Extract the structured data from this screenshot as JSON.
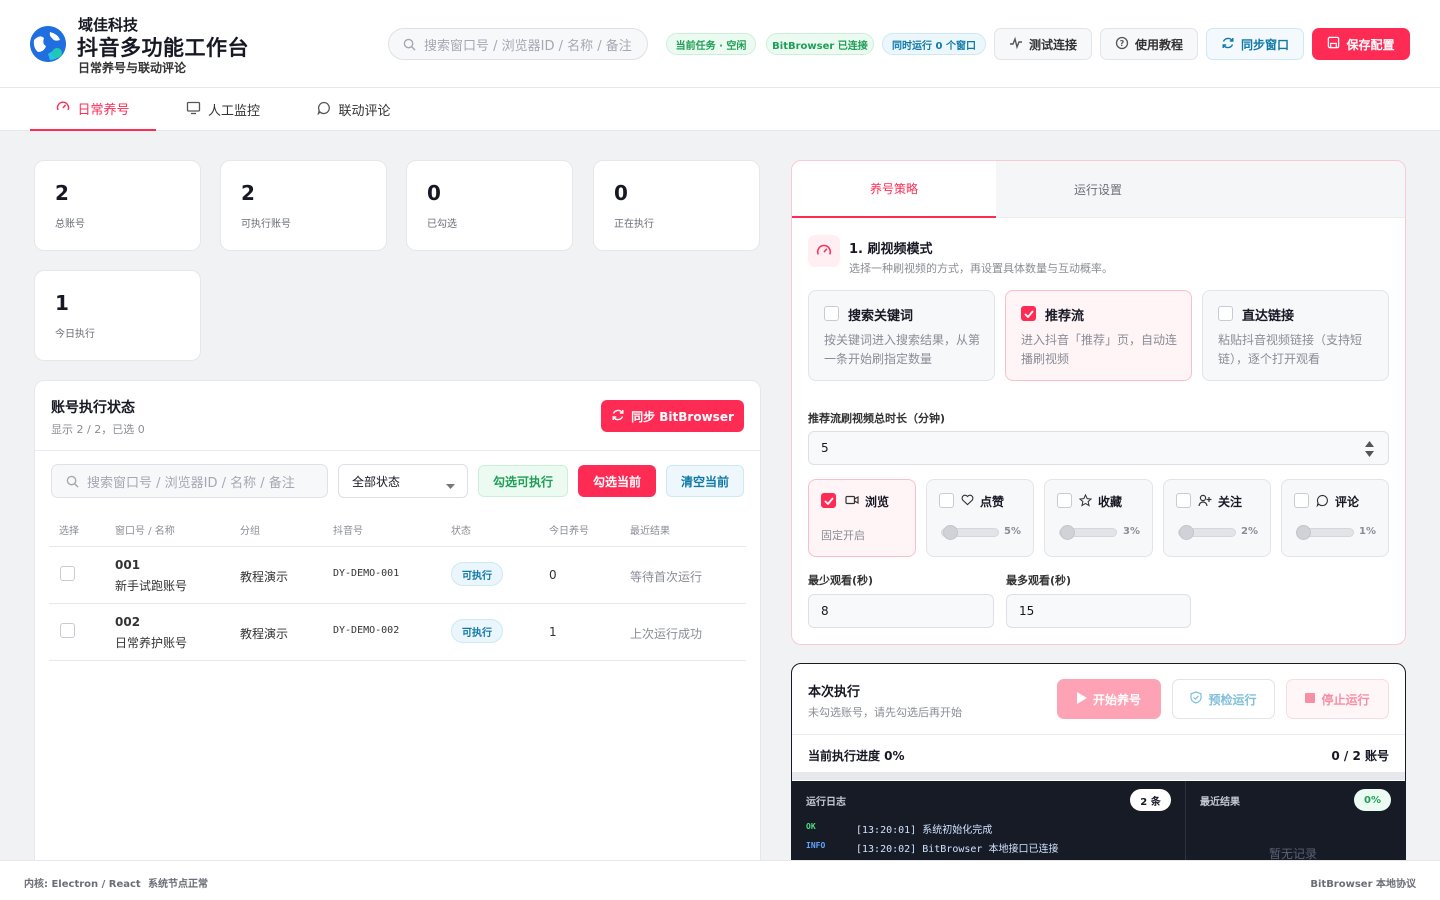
{
  "brand": {
    "company": "域佳科技",
    "title": "抖音多功能工作台",
    "subtitle": "日常养号与联动评论"
  },
  "header": {
    "search_placeholder": "搜索窗口号 / 浏览器ID / 名称 / 备注",
    "status_task": "当前任务 · 空闲",
    "status_browser": "BitBrowser 已连接",
    "status_concurrency": "同时运行 0 个窗口",
    "test_connection": "测试连接",
    "tutorial": "使用教程",
    "sync_window": "同步窗口",
    "save_config": "保存配置"
  },
  "tabs": [
    {
      "label": "日常养号",
      "active": true
    },
    {
      "label": "人工监控",
      "active": false
    },
    {
      "label": "联动评论",
      "active": false
    }
  ],
  "stats": [
    {
      "value": "2",
      "label": "总账号"
    },
    {
      "value": "2",
      "label": "可执行账号"
    },
    {
      "value": "0",
      "label": "已勾选"
    },
    {
      "value": "0",
      "label": "正在执行"
    },
    {
      "value": "1",
      "label": "今日执行"
    }
  ],
  "accounts": {
    "title": "账号执行状态",
    "summary": "显示 2 / 2，已选 0",
    "sync_button": "同步 BitBrowser",
    "search_placeholder": "搜索窗口号 / 浏览器ID / 名称 / 备注",
    "status_filter": "全部状态",
    "select_runnable": "勾选可执行",
    "select_current": "勾选当前",
    "clear_current": "清空当前",
    "columns": [
      "选择",
      "窗口号 / 名称",
      "分组",
      "抖音号",
      "状态",
      "今日养号",
      "最近结果"
    ],
    "rows": [
      {
        "no": "001",
        "name": "新手试跑账号",
        "group": "教程演示",
        "douyin": "DY-DEMO-001",
        "status": "可执行",
        "today": "0",
        "result": "等待首次运行"
      },
      {
        "no": "002",
        "name": "日常养护账号",
        "group": "教程演示",
        "douyin": "DY-DEMO-002",
        "status": "可执行",
        "today": "1",
        "result": "上次运行成功"
      }
    ]
  },
  "strategy": {
    "tabs": [
      "养号策略",
      "运行设置"
    ],
    "section_title": "1. 刷视频模式",
    "section_desc": "选择一种刷视频的方式，再设置具体数量与互动概率。",
    "modes": [
      {
        "title": "搜索关键词",
        "desc": "按关键词进入搜索结果，从第一条开始刷指定数量",
        "checked": false
      },
      {
        "title": "推荐流",
        "desc": "进入抖音「推荐」页，自动连播刷视频",
        "checked": true
      },
      {
        "title": "直达链接",
        "desc": "粘贴抖音视频链接（支持短链），逐个打开观看",
        "checked": false
      }
    ],
    "duration_label": "推荐流刷视频总时长（分钟)",
    "duration_value": "5",
    "actions": [
      {
        "label": "浏览",
        "icon": "video-icon",
        "checked": true,
        "note": "固定开启"
      },
      {
        "label": "点赞",
        "icon": "heart-icon",
        "checked": false,
        "pct_label": "5%",
        "pct": 0.05
      },
      {
        "label": "收藏",
        "icon": "star-icon",
        "checked": false,
        "pct_label": "3%",
        "pct": 0.03
      },
      {
        "label": "关注",
        "icon": "user-plus-icon",
        "checked": false,
        "pct_label": "2%",
        "pct": 0.02
      },
      {
        "label": "评论",
        "icon": "comment-icon",
        "checked": false,
        "pct_label": "1%",
        "pct": 0.01
      }
    ],
    "min_watch_label": "最少观看(秒)",
    "min_watch_value": "8",
    "max_watch_label": "最多观看(秒)",
    "max_watch_value": "15"
  },
  "run": {
    "title": "本次执行",
    "hint": "未勾选账号，请先勾选后再开始",
    "start": "开始养号",
    "precheck": "预检运行",
    "stop": "停止运行",
    "progress_label": "当前执行进度 0%",
    "progress_count": "0 / 2 账号",
    "log_title": "运行日志",
    "log_count": "2 条",
    "logs": [
      {
        "level": "OK",
        "text": "[13:20:01] 系统初始化完成"
      },
      {
        "level": "INFO",
        "text": "[13:20:02] BitBrowser 本地接口已连接"
      }
    ],
    "result_title": "最近结果",
    "result_pct": "0%",
    "result_empty": "暂无记录"
  },
  "footer": {
    "core": "内核: Electron / React",
    "node": "系统节点正常",
    "protocol": "BitBrowser 本地协议"
  },
  "colors": {
    "accent": "#fe2c55",
    "teal": "#1179a8",
    "green": "#1f9e55",
    "dark": "#161b26"
  }
}
